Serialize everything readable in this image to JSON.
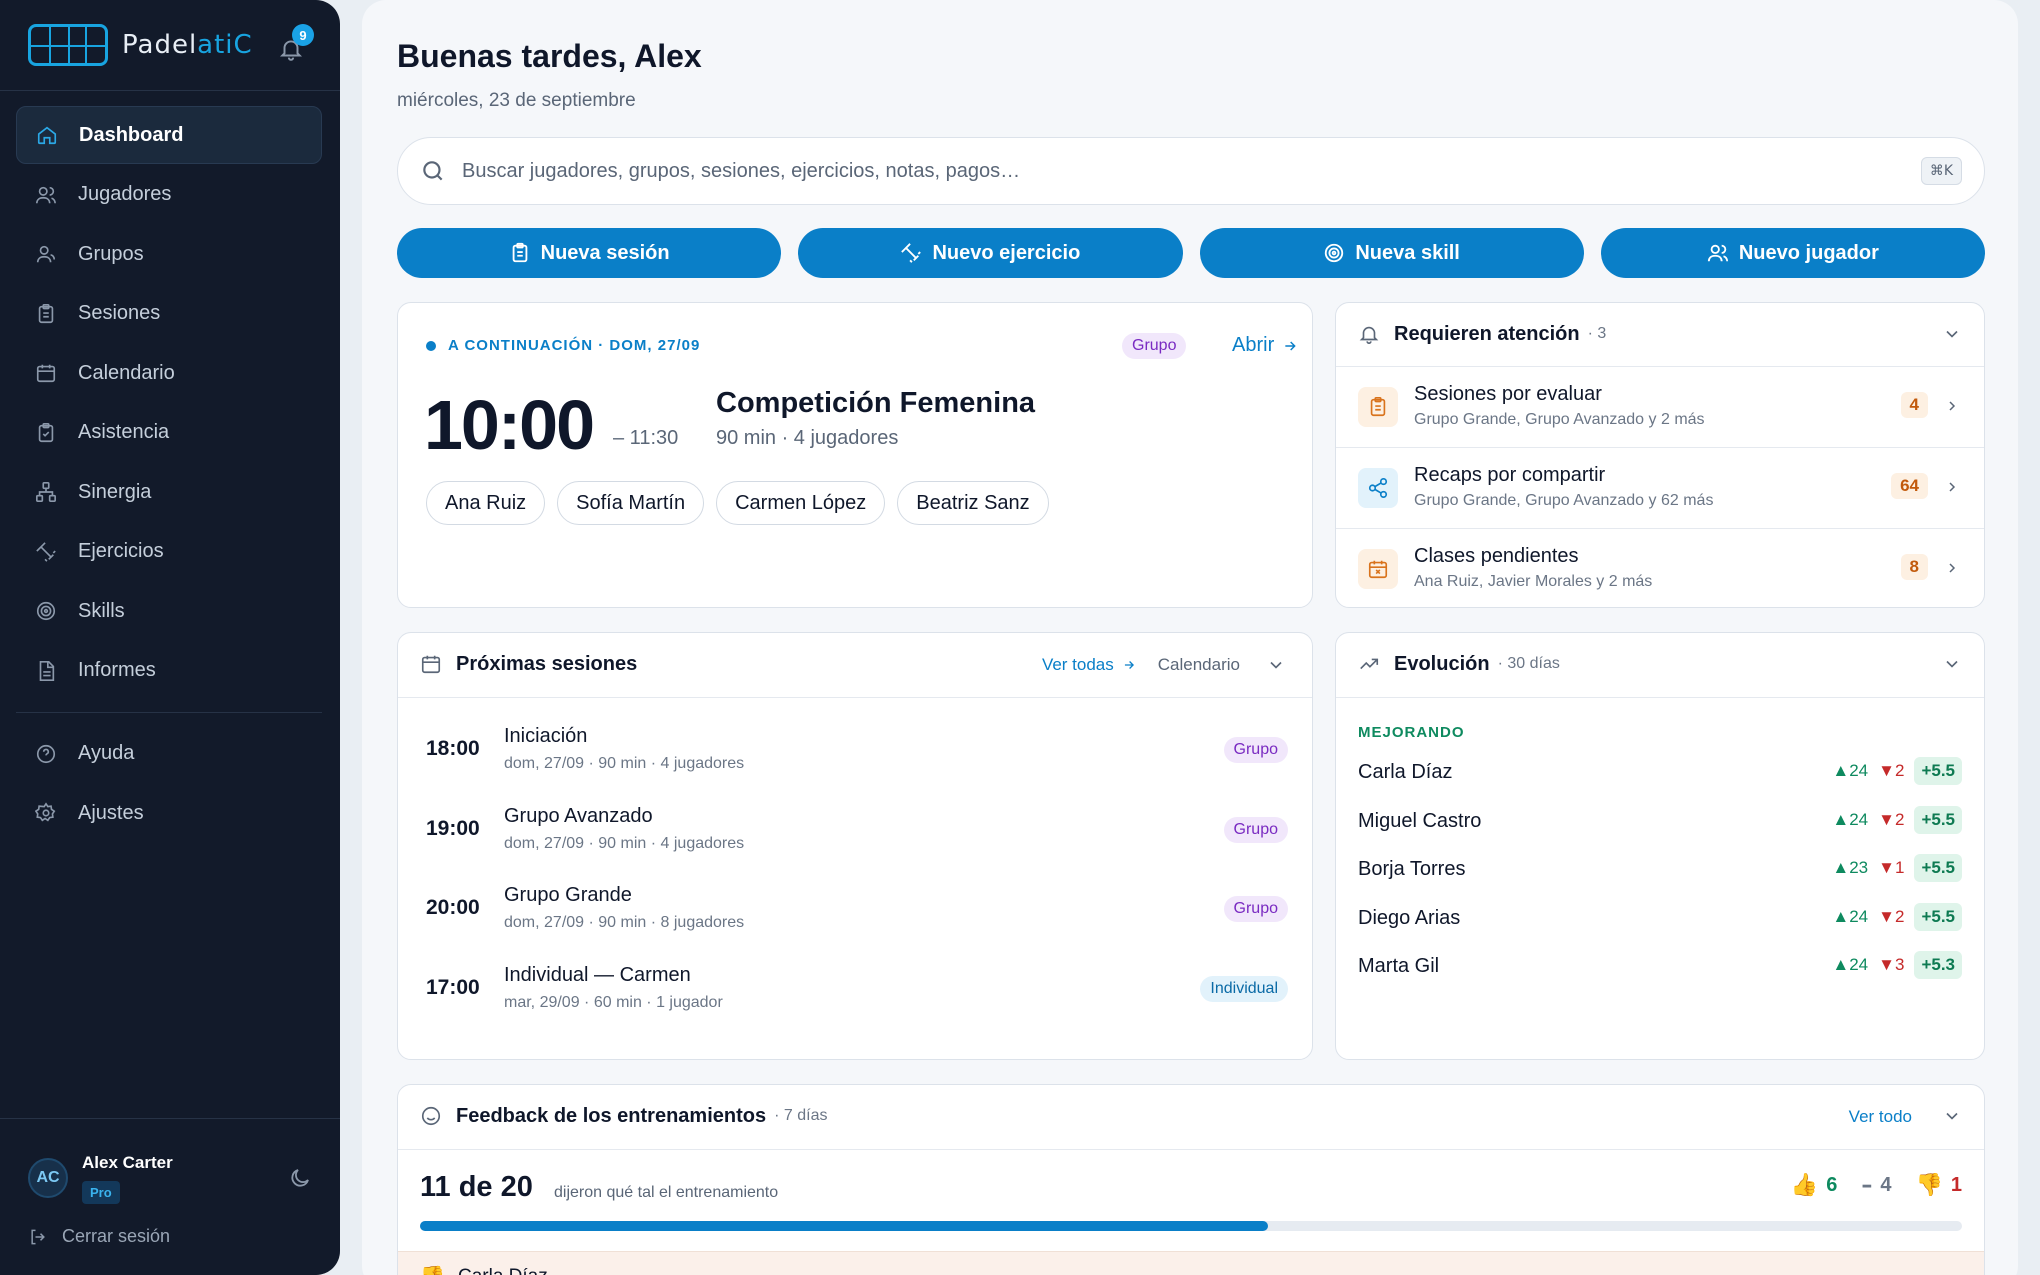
{
  "app": {
    "logo_part1": "Padel",
    "logo_part2": "atiC",
    "notification_count": "9"
  },
  "sidebar": {
    "items": [
      {
        "label": "Dashboard",
        "icon": "home-icon",
        "active": true
      },
      {
        "label": "Jugadores",
        "icon": "users-icon"
      },
      {
        "label": "Grupos",
        "icon": "group-icon"
      },
      {
        "label": "Sesiones",
        "icon": "clipboard-icon"
      },
      {
        "label": "Calendario",
        "icon": "calendar-icon"
      },
      {
        "label": "Asistencia",
        "icon": "clipboard-check-icon"
      },
      {
        "label": "Sinergia",
        "icon": "network-icon"
      },
      {
        "label": "Ejercicios",
        "icon": "dumbbell-icon"
      },
      {
        "label": "Skills",
        "icon": "target-icon"
      },
      {
        "label": "Informes",
        "icon": "document-icon"
      }
    ],
    "secondary": [
      {
        "label": "Ayuda",
        "icon": "help-icon"
      },
      {
        "label": "Ajustes",
        "icon": "gear-icon"
      }
    ],
    "user": {
      "initials": "AC",
      "name": "Alex Carter",
      "plan": "Pro"
    },
    "logout_label": "Cerrar sesión"
  },
  "header": {
    "greeting": "Buenas tardes, Alex",
    "date": "miércoles, 23 de septiembre"
  },
  "search": {
    "placeholder": "Buscar jugadores, grupos, sesiones, ejercicios, notas, pagos…",
    "shortcut": "⌘K"
  },
  "actions": [
    {
      "label": "Nueva sesión",
      "icon": "clipboard-icon"
    },
    {
      "label": "Nuevo ejercicio",
      "icon": "dumbbell-icon"
    },
    {
      "label": "Nueva skill",
      "icon": "target-icon"
    },
    {
      "label": "Nuevo jugador",
      "icon": "users-icon"
    }
  ],
  "next_session": {
    "heading": "A CONTINUACIÓN · DOM, 27/09",
    "tag": "Grupo",
    "open_label": "Abrir",
    "start": "10:00",
    "end": "– 11:30",
    "title": "Competición Femenina",
    "meta": "90 min · 4 jugadores",
    "players": [
      "Ana Ruiz",
      "Sofía Martín",
      "Carmen López",
      "Beatriz Sanz"
    ]
  },
  "attention": {
    "title": "Requieren atención",
    "count": "· 3",
    "items": [
      {
        "title": "Sesiones por evaluar",
        "sub": "Grupo Grande, Grupo Avanzado y 2 más",
        "count": "4",
        "icon": "clipboard-icon",
        "color": "#d9731c",
        "bg": "#fdf0e2"
      },
      {
        "title": "Recaps por compartir",
        "sub": "Grupo Grande, Grupo Avanzado y 62 más",
        "count": "64",
        "icon": "share-icon",
        "color": "#0a7fc8",
        "bg": "#e2f2fb"
      },
      {
        "title": "Clases pendientes",
        "sub": "Ana Ruiz, Javier Morales y 2 más",
        "count": "8",
        "icon": "calendar-x-icon",
        "color": "#d9731c",
        "bg": "#fdf0e2"
      }
    ]
  },
  "upcoming": {
    "title": "Próximas sesiones",
    "see_all": "Ver todas",
    "calendar": "Calendario",
    "rows": [
      {
        "time": "18:00",
        "title": "Iniciación",
        "meta": "dom, 27/09 · 90 min · 4 jugadores",
        "tag": "Grupo",
        "kind": "grupo"
      },
      {
        "time": "19:00",
        "title": "Grupo Avanzado",
        "meta": "dom, 27/09 · 90 min · 4 jugadores",
        "tag": "Grupo",
        "kind": "grupo"
      },
      {
        "time": "20:00",
        "title": "Grupo Grande",
        "meta": "dom, 27/09 · 90 min · 8 jugadores",
        "tag": "Grupo",
        "kind": "grupo"
      },
      {
        "time": "17:00",
        "title": "Individual — Carmen",
        "meta": "mar, 29/09 · 60 min · 1 jugador",
        "tag": "Individual",
        "kind": "ind"
      }
    ]
  },
  "evolution": {
    "title": "Evolución",
    "period": "· 30 días",
    "section": "MEJORANDO",
    "rows": [
      {
        "name": "Carla Díaz",
        "up": "▲24",
        "down": "▼2",
        "delta": "+5.5"
      },
      {
        "name": "Miguel Castro",
        "up": "▲24",
        "down": "▼2",
        "delta": "+5.5"
      },
      {
        "name": "Borja Torres",
        "up": "▲23",
        "down": "▼1",
        "delta": "+5.5"
      },
      {
        "name": "Diego Arias",
        "up": "▲24",
        "down": "▼2",
        "delta": "+5.5"
      },
      {
        "name": "Marta Gil",
        "up": "▲24",
        "down": "▼3",
        "delta": "+5.3"
      }
    ]
  },
  "feedback": {
    "title": "Feedback de los entrenamientos",
    "period": "· 7 días",
    "see_all": "Ver todo",
    "count": "11 de 20",
    "count_sub": "dijeron qué tal el entrenamiento",
    "progress": 0.55,
    "positive": "6",
    "neutral": "4",
    "negative": "1",
    "first_row": "Carla Díaz"
  }
}
